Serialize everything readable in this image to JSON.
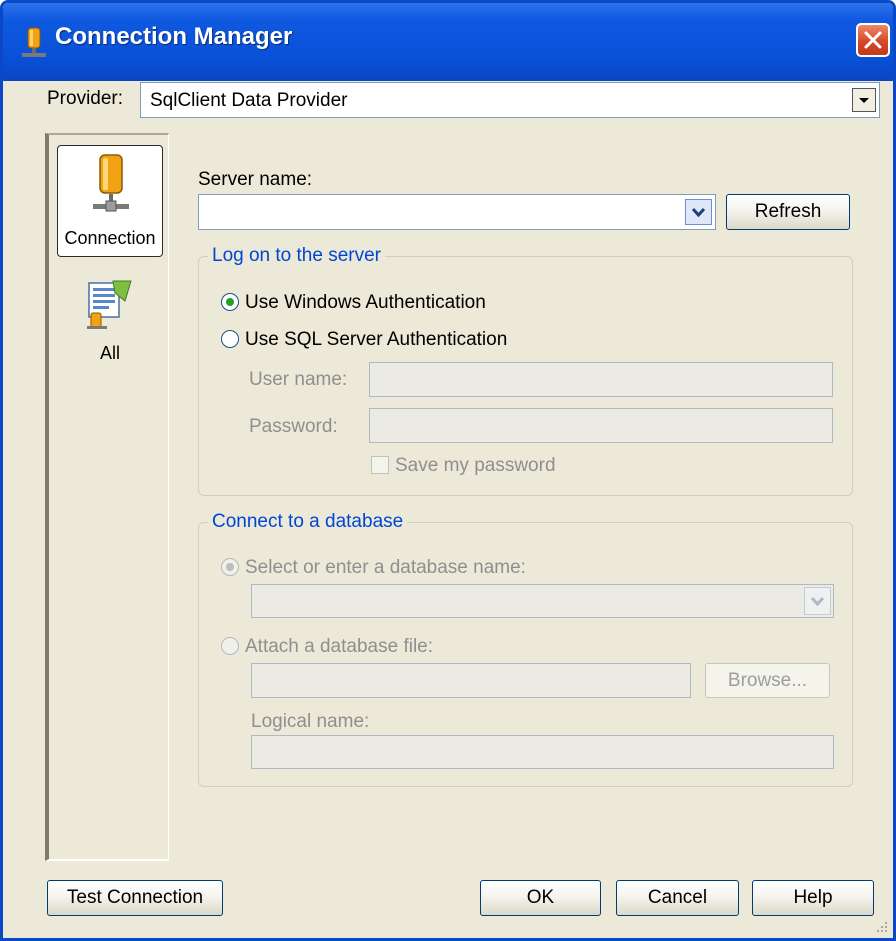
{
  "window": {
    "title": "Connection Manager"
  },
  "provider": {
    "label": "Provider:",
    "value": "SqlClient Data Provider"
  },
  "nav": {
    "items": [
      {
        "label": "Connection",
        "icon": "database-server-icon",
        "selected": true
      },
      {
        "label": "All",
        "icon": "properties-sheet-icon",
        "selected": false
      }
    ]
  },
  "server": {
    "label": "Server name:",
    "value": "",
    "refresh_label": "Refresh"
  },
  "logon": {
    "title": "Log on to the server",
    "windows_auth_label": "Use Windows Authentication",
    "sql_auth_label": "Use SQL Server Authentication",
    "selected": "Use Windows Authentication",
    "username_label": "User name:",
    "username_value": "",
    "password_label": "Password:",
    "password_value": "",
    "save_password_label": "Save my password",
    "save_password_checked": false
  },
  "database": {
    "title": "Connect to a database",
    "select_label": "Select or enter a database name:",
    "select_value": "",
    "attach_label": "Attach a database file:",
    "attach_value": "",
    "browse_label": "Browse...",
    "logical_name_label": "Logical name:",
    "logical_name_value": ""
  },
  "buttons": {
    "test_connection": "Test Connection",
    "ok": "OK",
    "cancel": "Cancel",
    "help": "Help"
  },
  "colors": {
    "titlebar": "#0851d8",
    "dialog_bg": "#ece9d8",
    "group_title": "#0046d5",
    "radio_dot": "#21a121"
  }
}
